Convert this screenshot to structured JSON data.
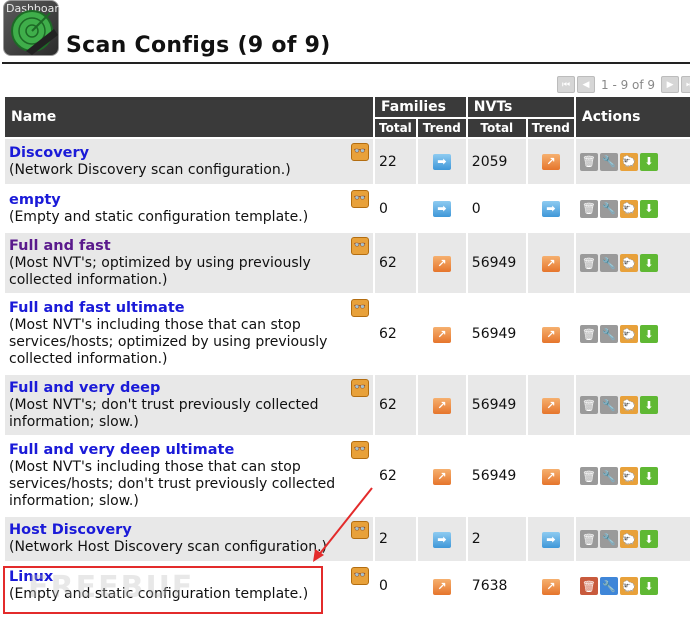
{
  "header": {
    "logo_text": "Dashboard",
    "title": "Scan Configs (9 of 9)"
  },
  "pager": {
    "text": "1 - 9 of 9"
  },
  "table": {
    "headers": {
      "name": "Name",
      "families": "Families",
      "nvts": "NVTs",
      "actions": "Actions",
      "total": "Total",
      "trend": "Trend"
    },
    "rows": [
      {
        "name": "Discovery",
        "desc": "(Network Discovery scan configuration.)",
        "fam_total": "22",
        "fam_trend": "same",
        "nvt_total": "2059",
        "nvt_trend": "up"
      },
      {
        "name": "empty",
        "desc": "(Empty and static configuration template.)",
        "fam_total": "0",
        "fam_trend": "same",
        "nvt_total": "0",
        "nvt_trend": "same"
      },
      {
        "name": "Full and fast",
        "desc": "(Most NVT's; optimized by using previously collected information.)",
        "fam_total": "62",
        "fam_trend": "up",
        "nvt_total": "56949",
        "nvt_trend": "up"
      },
      {
        "name": "Full and fast ultimate",
        "desc": "(Most NVT's including those that can stop services/hosts; optimized by using previously collected information.)",
        "fam_total": "62",
        "fam_trend": "up",
        "nvt_total": "56949",
        "nvt_trend": "up"
      },
      {
        "name": "Full and very deep",
        "desc": "(Most NVT's; don't trust previously collected information; slow.)",
        "fam_total": "62",
        "fam_trend": "up",
        "nvt_total": "56949",
        "nvt_trend": "up"
      },
      {
        "name": "Full and very deep ultimate",
        "desc": "(Most NVT's including those that can stop services/hosts; don't trust previously collected information; slow.)",
        "fam_total": "62",
        "fam_trend": "up",
        "nvt_total": "56949",
        "nvt_trend": "up"
      },
      {
        "name": "Host Discovery",
        "desc": "(Network Host Discovery scan configuration.)",
        "fam_total": "2",
        "fam_trend": "same",
        "nvt_total": "2",
        "nvt_trend": "same"
      },
      {
        "name": "Linux",
        "desc": "(Empty and static configuration template.)",
        "fam_total": "0",
        "fam_trend": "up",
        "nvt_total": "7638",
        "nvt_trend": "up"
      }
    ]
  },
  "icons": {
    "details": "glasses-icon",
    "trend_up": "trend-up-arrow-icon",
    "trend_same": "trend-same-arrow-icon",
    "delete": "trash-icon",
    "edit": "wrench-icon",
    "clone": "clone-icon",
    "export": "download-icon"
  },
  "colors": {
    "header_bg": "#3a3a3a",
    "link": "#1a1ad8",
    "highlight": "#e32b2b",
    "trend_up": "#e6752c",
    "trend_same": "#3f97d8"
  }
}
